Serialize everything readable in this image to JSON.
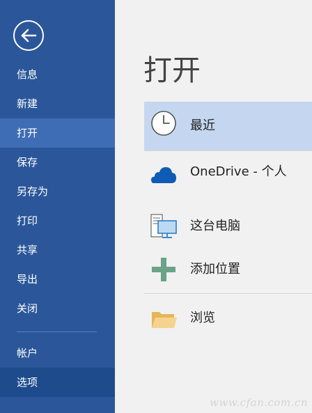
{
  "sidebar": {
    "back_icon": "back-arrow-icon",
    "items": [
      {
        "label": "信息"
      },
      {
        "label": "新建"
      },
      {
        "label": "打开"
      },
      {
        "label": "保存"
      },
      {
        "label": "另存为"
      },
      {
        "label": "打印"
      },
      {
        "label": "共享"
      },
      {
        "label": "导出"
      },
      {
        "label": "关闭"
      }
    ],
    "footer_items": [
      {
        "label": "帐户"
      },
      {
        "label": "选项"
      }
    ],
    "colors": {
      "background": "#2b579a",
      "active": "#3e6db5",
      "footer_active": "#1e4b8c"
    }
  },
  "main": {
    "title": "打开",
    "locations": [
      {
        "label": "最近",
        "icon": "clock-icon",
        "selected": true
      },
      {
        "label": "OneDrive - 个人",
        "icon": "onedrive-cloud-icon"
      },
      {
        "label": "这台电脑",
        "icon": "computer-icon"
      },
      {
        "label": "添加位置",
        "icon": "plus-icon"
      },
      {
        "label": "浏览",
        "icon": "folder-icon"
      }
    ],
    "colors": {
      "selected": "#c5d7f0",
      "onedrive": "#0f5cb5",
      "plus": "#6aa387",
      "folder": "#f0c677"
    }
  },
  "watermark": "www.cfan.com.cn"
}
